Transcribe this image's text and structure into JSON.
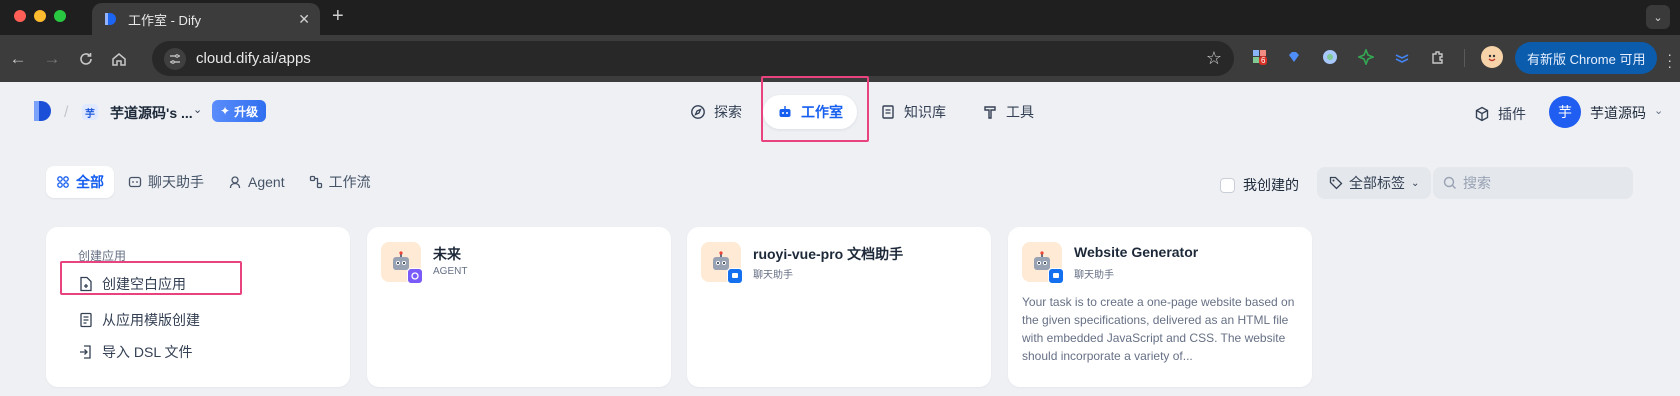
{
  "browser": {
    "tab_title": "工作室 - Dify",
    "url": "cloud.dify.ai/apps",
    "extension_badge": "6",
    "update_button": "有新版 Chrome 可用"
  },
  "header": {
    "workspace_badge": "芋",
    "workspace_name": "芋道源码's ...",
    "upgrade_label": "升级",
    "nav": {
      "explore": "探索",
      "studio": "工作室",
      "knowledge": "知识库",
      "tools": "工具"
    },
    "plugins_label": "插件",
    "avatar_letter": "芋",
    "user_name": "芋道源码"
  },
  "filters": {
    "tabs": [
      "全部",
      "聊天助手",
      "Agent",
      "工作流"
    ],
    "created_by_me": "我创建的",
    "all_tags": "全部标签",
    "search_placeholder": "搜索"
  },
  "create_card": {
    "title": "创建应用",
    "blank_app": "创建空白应用",
    "from_template": "从应用模版创建",
    "import_dsl": "导入 DSL 文件"
  },
  "apps": [
    {
      "name": "未来",
      "type": "AGENT",
      "description": ""
    },
    {
      "name": "ruoyi-vue-pro 文档助手",
      "type": "聊天助手",
      "description": ""
    },
    {
      "name": "Website Generator",
      "type": "聊天助手",
      "description": "Your task is to create a one-page website based on the given specifications, delivered as an HTML file with embedded JavaScript and CSS. The website should incorporate a variety of..."
    }
  ],
  "colors": {
    "accent": "#155eef",
    "highlight_box": "#e8437f",
    "agent_badge": "#7a5af8",
    "chat_badge": "#1570ef",
    "icon_bg": "#ffead5"
  },
  "icons": {
    "explore": "compass-icon",
    "studio": "robot-icon",
    "knowledge": "book-icon",
    "tools": "hammer-icon",
    "plugins": "cube-icon"
  }
}
